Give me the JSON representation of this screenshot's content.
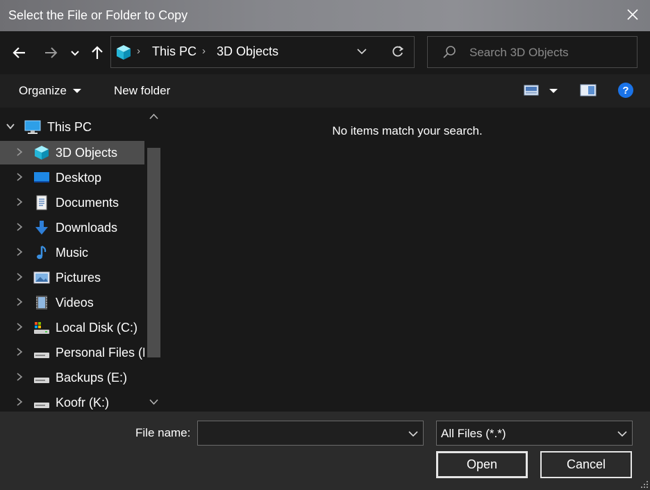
{
  "window": {
    "title": "Select the File or Folder to Copy"
  },
  "address": {
    "crumbs": [
      "This PC",
      "3D Objects"
    ]
  },
  "search": {
    "placeholder": "Search 3D Objects"
  },
  "toolbar": {
    "organize_label": "Organize",
    "new_folder_label": "New folder"
  },
  "sidebar": {
    "items": [
      {
        "label": "This PC",
        "icon": "pc-icon",
        "expanded": true
      },
      {
        "label": "3D Objects",
        "icon": "3d-objects-icon",
        "selected": true
      },
      {
        "label": "Desktop",
        "icon": "desktop-icon"
      },
      {
        "label": "Documents",
        "icon": "documents-icon"
      },
      {
        "label": "Downloads",
        "icon": "downloads-icon"
      },
      {
        "label": "Music",
        "icon": "music-icon"
      },
      {
        "label": "Pictures",
        "icon": "pictures-icon"
      },
      {
        "label": "Videos",
        "icon": "videos-icon"
      },
      {
        "label": "Local Disk (C:)",
        "icon": "local-disk-icon"
      },
      {
        "label": "Personal Files (D",
        "icon": "drive-icon"
      },
      {
        "label": "Backups (E:)",
        "icon": "drive-icon"
      },
      {
        "label": "Koofr (K:)",
        "icon": "drive-icon"
      }
    ]
  },
  "content": {
    "empty_message": "No items match your search."
  },
  "footer": {
    "file_name_label": "File name:",
    "file_name_value": "",
    "filter_value": "All Files (*.*)",
    "open_label": "Open",
    "cancel_label": "Cancel"
  },
  "colors": {
    "accent": "#0078d7",
    "help": "#1a73e8",
    "selected_row": "#4d4d4d"
  }
}
